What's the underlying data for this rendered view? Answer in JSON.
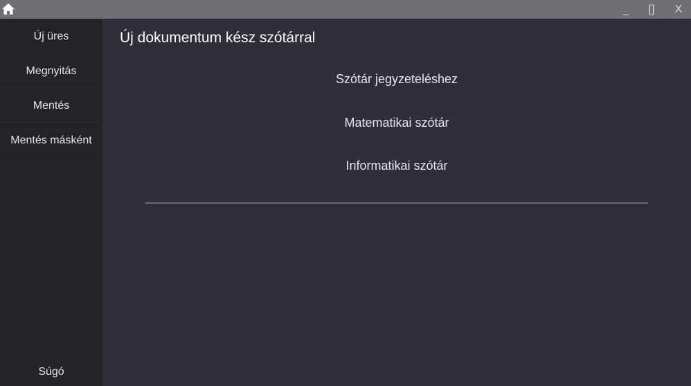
{
  "window": {
    "home_icon": "home-icon",
    "minimize_label": "_",
    "maximize_label": "[]",
    "close_label": "X"
  },
  "sidebar": {
    "items": [
      {
        "label": "Új üres"
      },
      {
        "label": "Megnyitás"
      },
      {
        "label": "Mentés"
      },
      {
        "label": "Mentés másként"
      }
    ],
    "help_label": "Súgó"
  },
  "main": {
    "title": "Új dokumentum kész szótárral",
    "options": [
      {
        "label": "Szótár jegyzeteléshez"
      },
      {
        "label": "Matematikai szótár"
      },
      {
        "label": "Informatikai szótár"
      }
    ]
  },
  "colors": {
    "titlebar": "#6e6f73",
    "sidebar": "#242428",
    "main": "#2f3037",
    "text": "#e6e6ea"
  }
}
